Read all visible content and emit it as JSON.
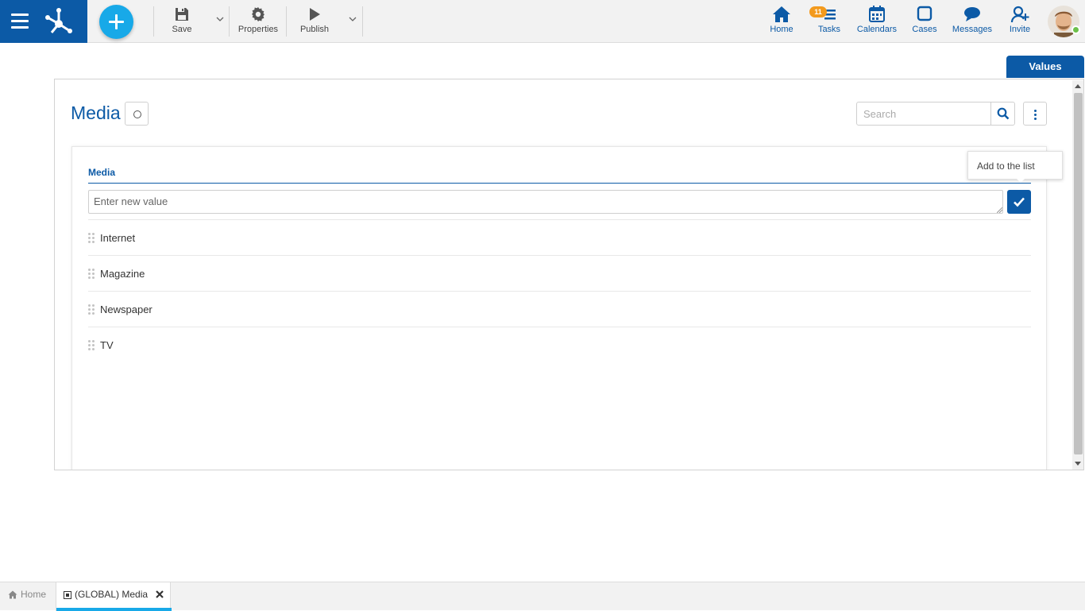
{
  "toolbar": {
    "save_label": "Save",
    "properties_label": "Properties",
    "publish_label": "Publish"
  },
  "nav": {
    "home": "Home",
    "tasks": "Tasks",
    "tasks_badge": "11",
    "calendars": "Calendars",
    "cases": "Cases",
    "messages": "Messages",
    "invite": "Invite"
  },
  "values_button": "Values",
  "page": {
    "title": "Media",
    "search_placeholder": "Search"
  },
  "field": {
    "label": "Media",
    "new_value_placeholder": "Enter new value",
    "add_tooltip": "Add to the list"
  },
  "list_items": [
    "Internet",
    "Magazine",
    "Newspaper",
    "TV"
  ],
  "bottom_tabs": {
    "home": "Home",
    "active": "(GLOBAL) Media"
  },
  "colors": {
    "brand_blue": "#0c5aa6",
    "accent_cyan": "#18a9e8",
    "badge_orange": "#f39a1d",
    "online_green": "#6cc04a"
  },
  "icons": [
    "menu-icon",
    "brand-icon",
    "plus-icon",
    "save-icon",
    "gear-icon",
    "play-icon",
    "chevron-down-icon",
    "home-icon",
    "tasks-icon",
    "calendar-icon",
    "cases-icon",
    "messages-icon",
    "invite-icon",
    "search-icon",
    "kebab-icon",
    "check-icon",
    "drag-handle-icon",
    "close-icon",
    "form-icon"
  ]
}
